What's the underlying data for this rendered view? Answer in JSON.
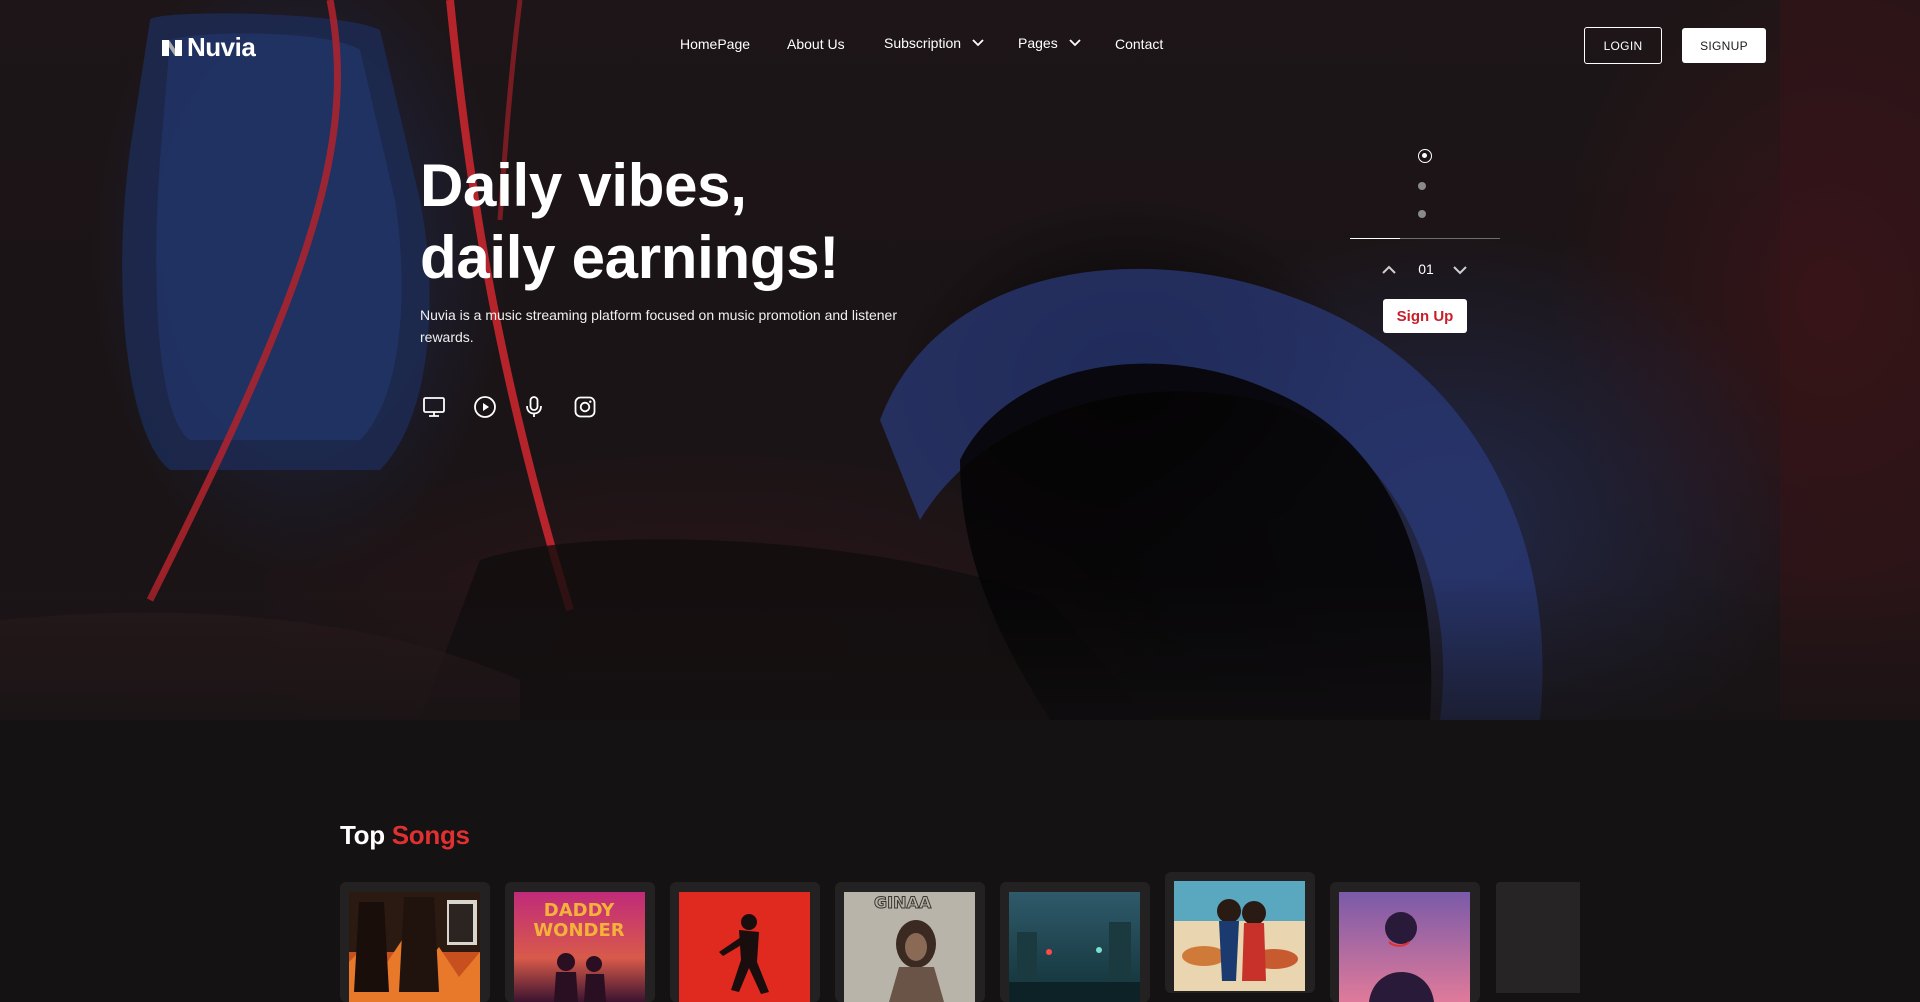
{
  "brand": {
    "name": "Nuvia"
  },
  "nav": {
    "items": [
      {
        "label": "HomePage",
        "has_dropdown": false
      },
      {
        "label": "About Us",
        "has_dropdown": false
      },
      {
        "label": "Subscription",
        "has_dropdown": true
      },
      {
        "label": "Pages",
        "has_dropdown": true
      },
      {
        "label": "Contact",
        "has_dropdown": false
      }
    ],
    "login_label": "LOGIN",
    "signup_label": "SIGNUP"
  },
  "hero": {
    "headline_line1": "Daily vibes,",
    "headline_line2": "daily earnings!",
    "subtitle": "Nuvia is a music streaming platform focused on music promotion and listener rewards.",
    "social_icons": [
      "desktop-icon",
      "play-circle-icon",
      "microphone-icon",
      "instagram-icon"
    ],
    "slider": {
      "current": "01",
      "total_slides": 3,
      "active_index": 0,
      "progress": 0.33
    },
    "cta_label": "Sign Up"
  },
  "top_songs": {
    "title_part1": "Top",
    "title_part2": "Songs",
    "covers": [
      {
        "name": "cover-1",
        "featured": false
      },
      {
        "name": "cover-daddy-wonder",
        "text": "DADDY WONDER",
        "featured": false
      },
      {
        "name": "cover-3",
        "featured": false
      },
      {
        "name": "cover-ginaa",
        "text": "GINAA",
        "featured": false
      },
      {
        "name": "cover-5",
        "featured": false
      },
      {
        "name": "cover-6",
        "featured": true
      },
      {
        "name": "cover-7",
        "featured": false
      }
    ]
  },
  "colors": {
    "accent": "#e0302f",
    "background": "#141213",
    "card": "#232122",
    "text": "#ffffff"
  }
}
